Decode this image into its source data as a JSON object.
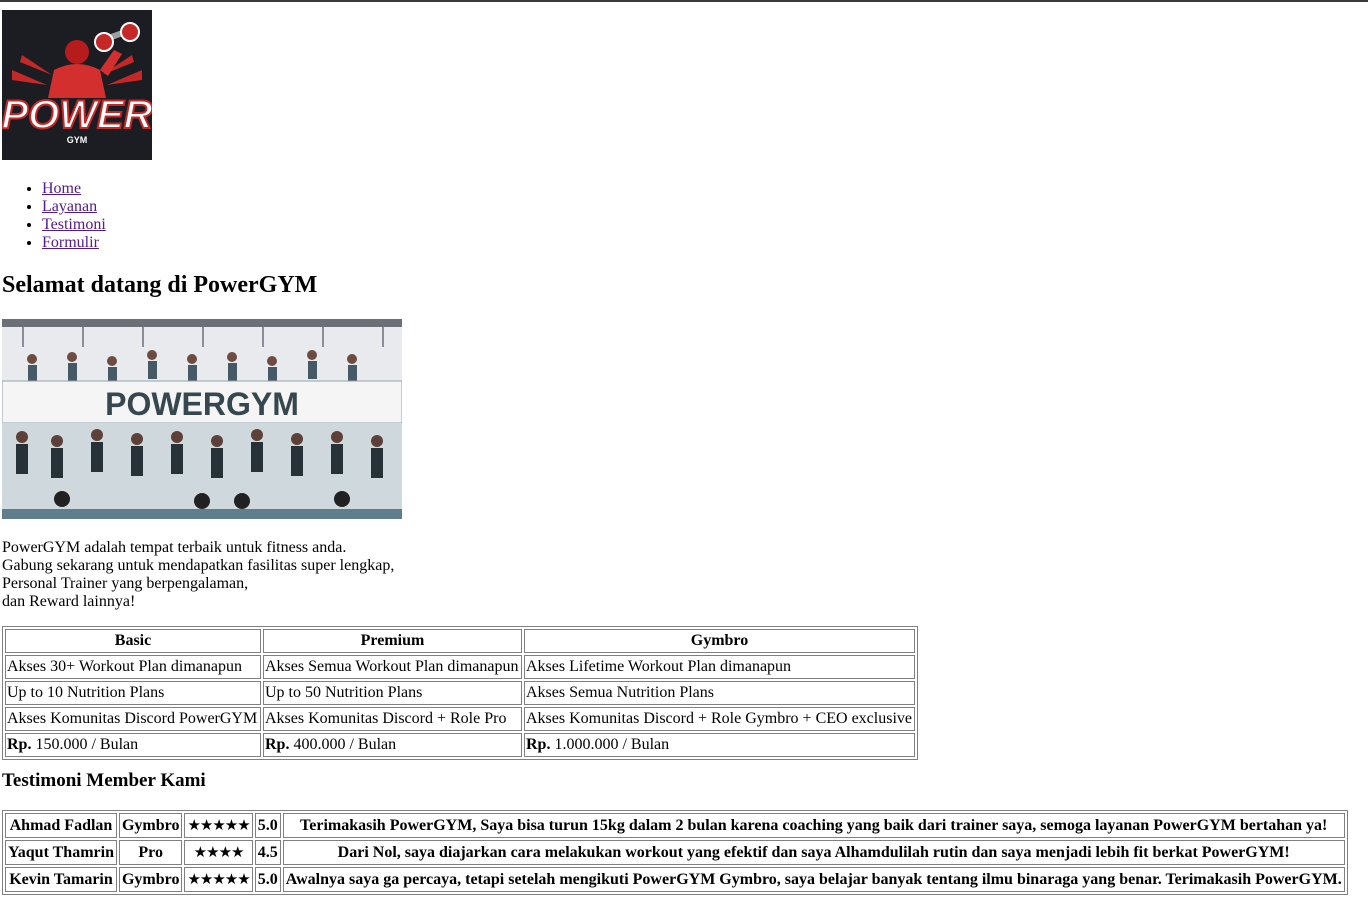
{
  "logo": {
    "brand_word": "POWER",
    "brand_sub": "GYM",
    "colors": {
      "background": "#1b1d22",
      "accent": "#d32f2f",
      "text": "#ffffff"
    }
  },
  "nav": {
    "items": [
      "Home",
      "Layanan",
      "Testimoni",
      "Formulir"
    ]
  },
  "welcome_title": "Selamat datang di PowerGYM",
  "hero": {
    "banner_text": "POWERGYM"
  },
  "intro_lines": [
    "PowerGYM adalah tempat terbaik untuk fitness anda.",
    "Gabung sekarang untuk mendapatkan fasilitas super lengkap,",
    "Personal Trainer yang berpengalaman,",
    "dan Reward lainnya!"
  ],
  "pricing": {
    "headers": [
      "Basic",
      "Premium",
      "Gymbro"
    ],
    "rows": [
      [
        "Akses 30+ Workout Plan dimanapun",
        "Akses Semua Workout Plan dimanapun",
        "Akses Lifetime Workout Plan dimanapun"
      ],
      [
        "Up to 10 Nutrition Plans",
        "Up to 50 Nutrition Plans",
        "Akses Semua Nutrition Plans"
      ],
      [
        "Akses Komunitas Discord PowerGYM",
        "Akses Komunitas Discord + Role Pro",
        "Akses Komunitas Discord + Role Gymbro + CEO exclusive"
      ]
    ],
    "price_prefix": "Rp.",
    "prices": [
      "150.000 / Bulan",
      "400.000 / Bulan",
      "1.000.000 / Bulan"
    ]
  },
  "testimonials_title": "Testimoni Member Kami",
  "testimonials": [
    {
      "name": "Ahmad Fadlan",
      "plan": "Gymbro",
      "stars": "★★★★★",
      "rating": "5.0",
      "text": "Terimakasih PowerGYM, Saya bisa turun 15kg dalam 2 bulan karena coaching yang baik dari trainer saya, semoga layanan PowerGYM bertahan ya!"
    },
    {
      "name": "Yaqut Thamrin",
      "plan": "Pro",
      "stars": "★★★★",
      "rating": "4.5",
      "text": "Dari Nol, saya diajarkan cara melakukan workout yang efektif dan saya Alhamdulilah rutin dan saya menjadi lebih fit berkat PowerGYM!"
    },
    {
      "name": "Kevin Tamarin",
      "plan": "Gymbro",
      "stars": "★★★★★",
      "rating": "5.0",
      "text": "Awalnya saya ga percaya, tetapi setelah mengikuti PowerGYM Gymbro, saya belajar banyak tentang ilmu binaraga yang benar. Terimakasih PowerGYM."
    }
  ]
}
